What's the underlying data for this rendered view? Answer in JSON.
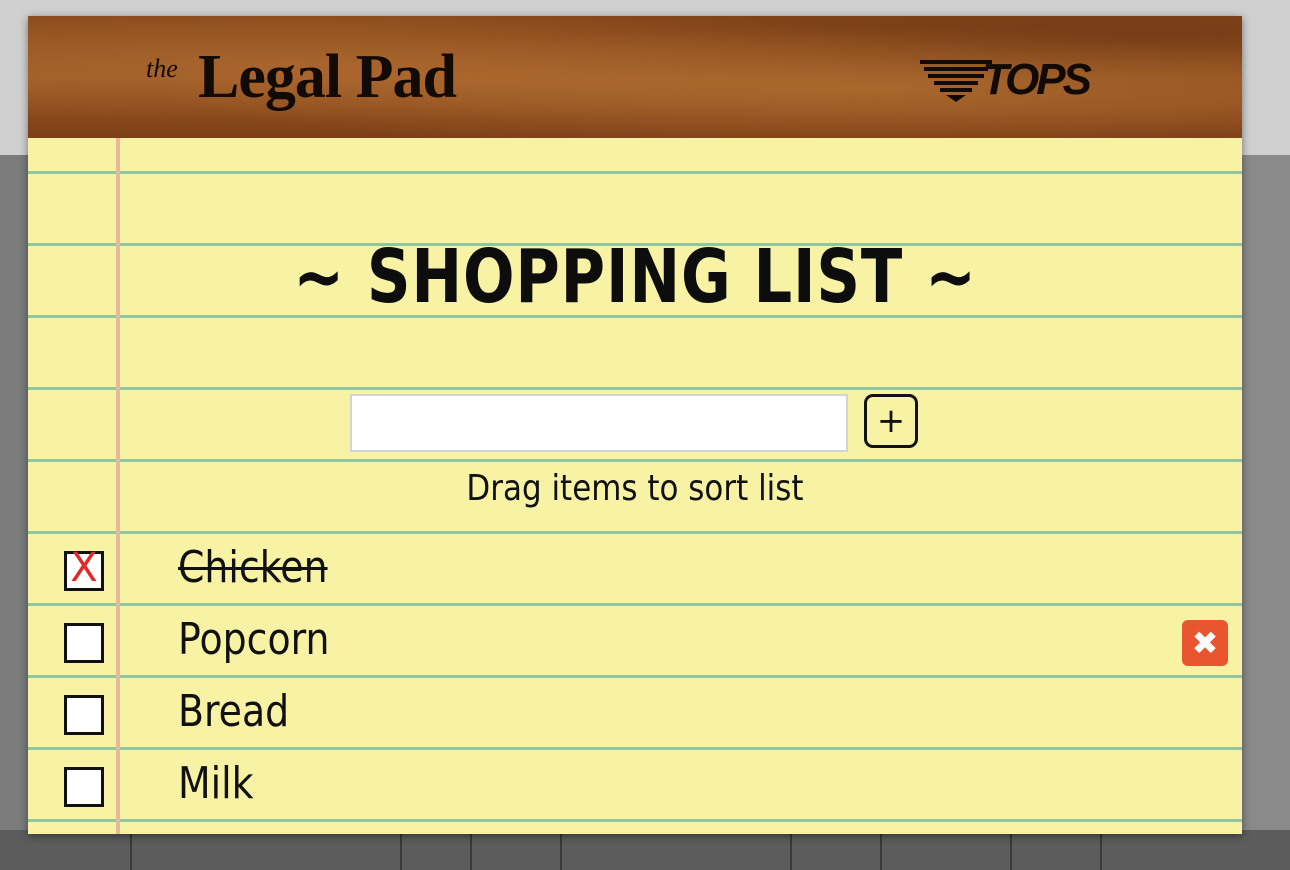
{
  "brand": {
    "the": "the",
    "name": "Legal Pad",
    "sponsor": "TOPS"
  },
  "list": {
    "title": "~ SHOPPING LIST ~",
    "input_value": "",
    "add_button": "+",
    "hint": "Drag items to sort list",
    "items": [
      {
        "label": "Chicken",
        "checked": true,
        "check_mark": "X"
      },
      {
        "label": "Popcorn",
        "checked": false,
        "delete_button": "✖"
      },
      {
        "label": "Bread",
        "checked": false
      },
      {
        "label": "Milk",
        "checked": false
      }
    ]
  },
  "colors": {
    "paper": "#f8f3a4",
    "rule_line": "#8ec6a0",
    "margin_line": "#e9b99a",
    "header_leather": "#8a4a1c",
    "check_x": "#e02a2a",
    "delete_button": "#e8552e"
  }
}
